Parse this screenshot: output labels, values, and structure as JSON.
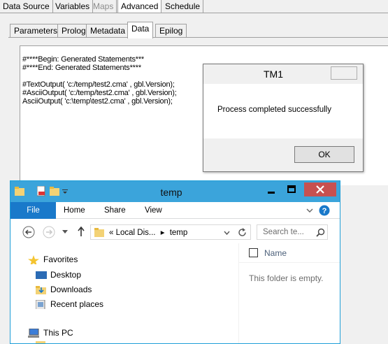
{
  "top_tabs": [
    {
      "label": "Data Source",
      "disabled": false
    },
    {
      "label": "Variables",
      "disabled": false
    },
    {
      "label": "Maps",
      "disabled": true
    },
    {
      "label": "Advanced",
      "disabled": false,
      "active": true
    },
    {
      "label": "Schedule",
      "disabled": false
    }
  ],
  "sub_tabs": [
    {
      "label": "Parameters"
    },
    {
      "label": "Prolog"
    },
    {
      "label": "Metadata"
    },
    {
      "label": "Data",
      "active": true
    },
    {
      "label": "Epilog"
    }
  ],
  "code_lines": [
    "#****Begin: Generated Statements***",
    "#****End: Generated Statements****",
    "",
    "#TextOutput( 'c:/temp/test2.cma' , gbl.Version);",
    "#AsciiOutput( 'c:/temp/test2.cma' , gbl.Version);",
    "AsciiOutput( 'c:\\temp\\test2.cma' , gbl.Version);"
  ],
  "dialog": {
    "title": "TM1",
    "close_glyph": "✕",
    "message": "Process completed successfully",
    "ok_label": "OK"
  },
  "explorer": {
    "title": "temp",
    "ribbon": {
      "file": "File",
      "home": "Home",
      "share": "Share",
      "view": "View"
    },
    "address": {
      "prefix": "«",
      "segment1": "Local Dis...",
      "sep": "▸",
      "segment2": "temp"
    },
    "search_placeholder": "Search te...",
    "nav": {
      "favorites": "Favorites",
      "desktop": "Desktop",
      "downloads": "Downloads",
      "recent": "Recent places",
      "this_pc": "This PC"
    },
    "column_name": "Name",
    "empty_text": "This folder is empty.",
    "colors": {
      "title_bar": "#3ba4db",
      "file_tab": "#1979ca",
      "close": "#c75050"
    }
  }
}
